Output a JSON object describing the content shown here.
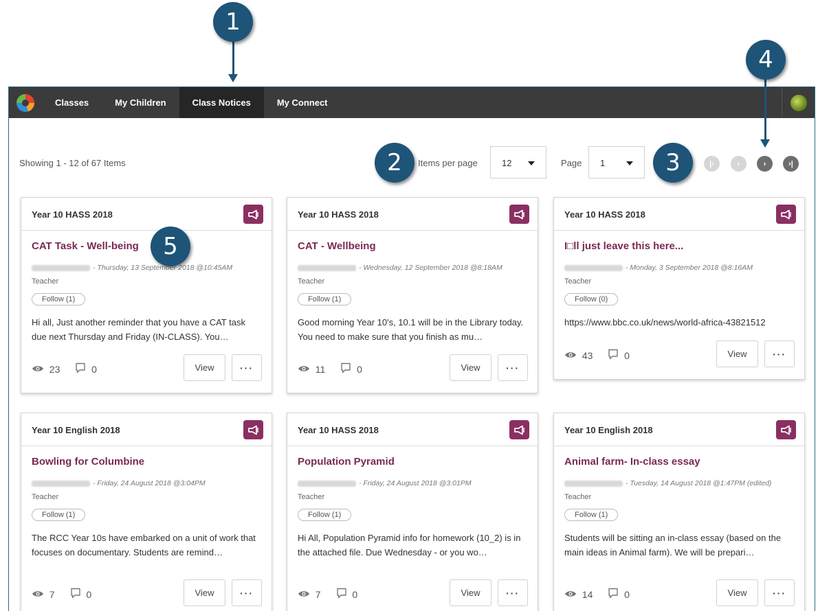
{
  "callouts": [
    "1",
    "2",
    "3",
    "4",
    "5"
  ],
  "nav": {
    "items": [
      "Classes",
      "My Children",
      "Class Notices",
      "My Connect"
    ],
    "active": "Class Notices"
  },
  "toolbar": {
    "showing": "Showing 1 - 12 of 67 Items",
    "items_per_page_label": "Items per page",
    "items_per_page_value": "12",
    "page_label": "Page",
    "page_value": "1",
    "first_icon": "first-page-icon",
    "prev_icon": "prev-page-icon",
    "next_icon": "next-page-icon",
    "last_icon": "last-page-icon"
  },
  "colors": {
    "navbar": "#3b3b3b",
    "nav_active": "#262626",
    "title_accent": "#7a2a55",
    "notice_icon_bg": "#8a2f62",
    "callout": "#1e5478"
  },
  "labels": {
    "view": "View",
    "more": "···",
    "role": "Teacher"
  },
  "cards": [
    {
      "class_name": "Year 10 HASS 2018",
      "title": "CAT Task - Well-being",
      "date": "- Thursday, 13 September 2018 @10:45AM",
      "follow": "Follow (1)",
      "body": "Hi all, Just another reminder that you have a CAT task due next Thursday and Friday (IN-CLASS). You…",
      "views": "23",
      "comments": "0"
    },
    {
      "class_name": "Year 10 HASS 2018",
      "title": "CAT - Wellbeing",
      "date": "- Wednesday, 12 September 2018 @8:18AM",
      "follow": "Follow (1)",
      "body": "Good morning Year 10's, 10.1 will be in the Library today. You need to make sure that you finish as mu…",
      "views": "11",
      "comments": "0"
    },
    {
      "class_name": "Year 10 HASS 2018",
      "title": "I□ll just leave this here...",
      "date": "- Monday, 3 September 2018 @8:16AM",
      "follow": "Follow (0)",
      "body": "https://www.bbc.co.uk/news/world-africa-43821512",
      "views": "43",
      "comments": "0"
    },
    {
      "class_name": "Year 10 English 2018",
      "title": "Bowling for Columbine",
      "date": "- Friday, 24 August 2018 @3:04PM",
      "follow": "Follow (1)",
      "body": "The RCC Year 10s have embarked on a unit of work that focuses on documentary. Students are remind…",
      "views": "7",
      "comments": "0"
    },
    {
      "class_name": "Year 10 HASS 2018",
      "title": "Population Pyramid",
      "date": "- Friday, 24 August 2018 @3:01PM",
      "follow": "Follow (1)",
      "body": "Hi All, Population Pyramid info for homework (10_2) is in the attached file. Due Wednesday - or you wo…",
      "views": "7",
      "comments": "0"
    },
    {
      "class_name": "Year 10 English 2018",
      "title": "Animal farm- In-class essay",
      "date": "- Tuesday, 14 August 2018 @1:47PM  (edited)",
      "follow": "Follow (1)",
      "body": "Students will be sitting an in-class essay (based on the main ideas in Animal farm). We will be prepari…",
      "views": "14",
      "comments": "0"
    }
  ]
}
